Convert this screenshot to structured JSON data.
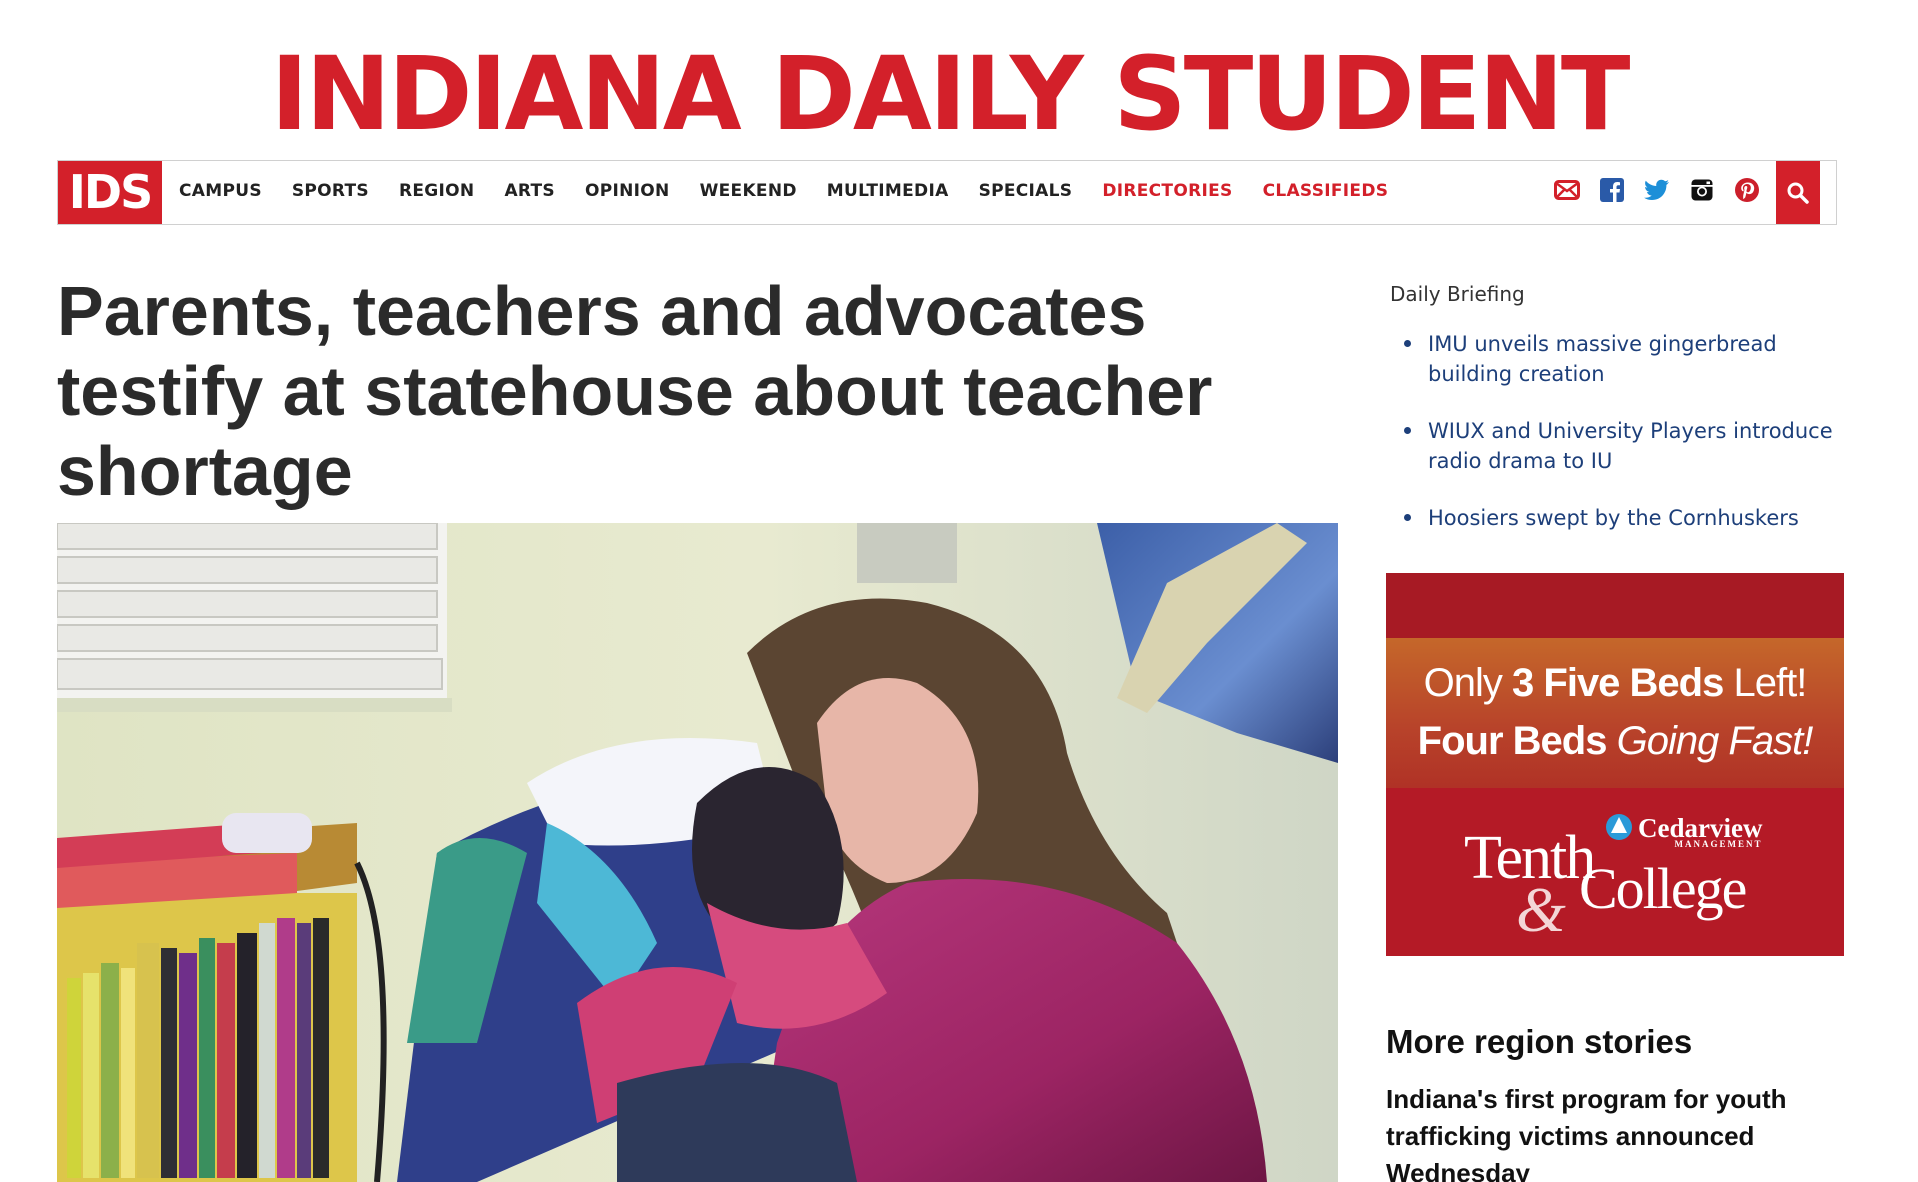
{
  "masthead": {
    "title": "INDIANA DAILY STUDENT"
  },
  "nav": {
    "logo": "IDS",
    "items": [
      {
        "label": "CAMPUS",
        "red": false
      },
      {
        "label": "SPORTS",
        "red": false
      },
      {
        "label": "REGION",
        "red": false
      },
      {
        "label": "ARTS",
        "red": false
      },
      {
        "label": "OPINION",
        "red": false
      },
      {
        "label": "WEEKEND",
        "red": false
      },
      {
        "label": "MULTIMEDIA",
        "red": false
      },
      {
        "label": "SPECIALS",
        "red": false
      },
      {
        "label": "DIRECTORIES",
        "red": true
      },
      {
        "label": "CLASSIFIEDS",
        "red": true
      }
    ],
    "social_icons": [
      "email-icon",
      "facebook-icon",
      "twitter-icon",
      "instagram-icon",
      "pinterest-icon"
    ],
    "search_icon": "search-icon"
  },
  "article": {
    "headline": "Parents, teachers and advocates testify at statehouse about teacher shortage"
  },
  "sidebar": {
    "briefing_title": "Daily Briefing",
    "briefing_items": [
      "IMU unveils massive gingerbread building creation",
      "WIUX and University Players introduce radio drama to IU",
      "Hoosiers swept by the Cornhuskers"
    ],
    "ad": {
      "only": "Only",
      "three_five_beds": "3 Five Beds",
      "left": "Left!",
      "four_beds": "Four Beds",
      "going_fast": "Going Fast!",
      "brand": "Cedarview",
      "brand_sub": "MANAGEMENT",
      "tenth": "Tenth",
      "amp": "&",
      "college": "College"
    },
    "more_title": "More region stories",
    "more_story": "Indiana's first program for youth trafficking victims announced Wednesday"
  },
  "colors": {
    "brand_red": "#d3202a",
    "link_blue": "#1d3f7a",
    "text_dark": "#2b2b2b"
  }
}
